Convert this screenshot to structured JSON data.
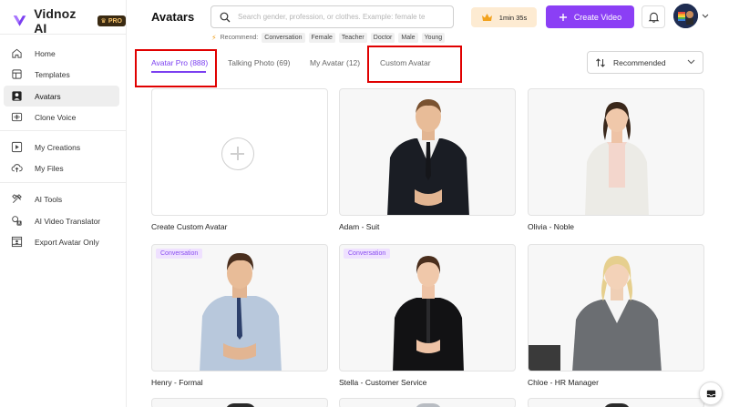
{
  "brand": {
    "name": "Vidnoz AI",
    "badge": "PRO"
  },
  "sidebar": {
    "items": [
      {
        "label": "Home",
        "icon": "home-icon"
      },
      {
        "label": "Templates",
        "icon": "templates-icon"
      },
      {
        "label": "Avatars",
        "icon": "avatar-icon",
        "active": true
      },
      {
        "label": "Clone Voice",
        "icon": "voice-icon"
      },
      {
        "label": "My Creations",
        "icon": "play-icon"
      },
      {
        "label": "My Files",
        "icon": "cloud-upload-icon"
      },
      {
        "label": "AI Tools",
        "icon": "tools-icon"
      },
      {
        "label": "AI Video Translator",
        "icon": "translate-icon"
      },
      {
        "label": "Export Avatar Only",
        "icon": "export-avatar-icon"
      }
    ]
  },
  "header": {
    "title": "Avatars",
    "search_placeholder": "Search gender, profession, or clothes. Example: female te",
    "recommend_label": "Recommend:",
    "recommend_chips": [
      "Conversation",
      "Female",
      "Teacher",
      "Doctor",
      "Male",
      "Young"
    ],
    "time_label": "1min 35s",
    "create_label": "Create Video"
  },
  "tabs": [
    {
      "label": "Avatar Pro (888)",
      "active": true
    },
    {
      "label": "Talking Photo (69)"
    },
    {
      "label": "My Avatar (12)"
    },
    {
      "label": "Custom Avatar"
    }
  ],
  "sort": {
    "label": "Recommended"
  },
  "cards": [
    {
      "name": "Create Custom Avatar",
      "type": "create"
    },
    {
      "name": "Adam - Suit"
    },
    {
      "name": "Olivia - Noble"
    },
    {
      "name": "Henry - Formal",
      "tag": "Conversation"
    },
    {
      "name": "Stella - Customer Service",
      "tag": "Conversation"
    },
    {
      "name": "Chloe - HR Manager"
    }
  ],
  "colors": {
    "accent": "#7b3ff0",
    "button": "#8b3ff5",
    "annotation": "#e00000",
    "time_pill": "#fdebd2"
  }
}
